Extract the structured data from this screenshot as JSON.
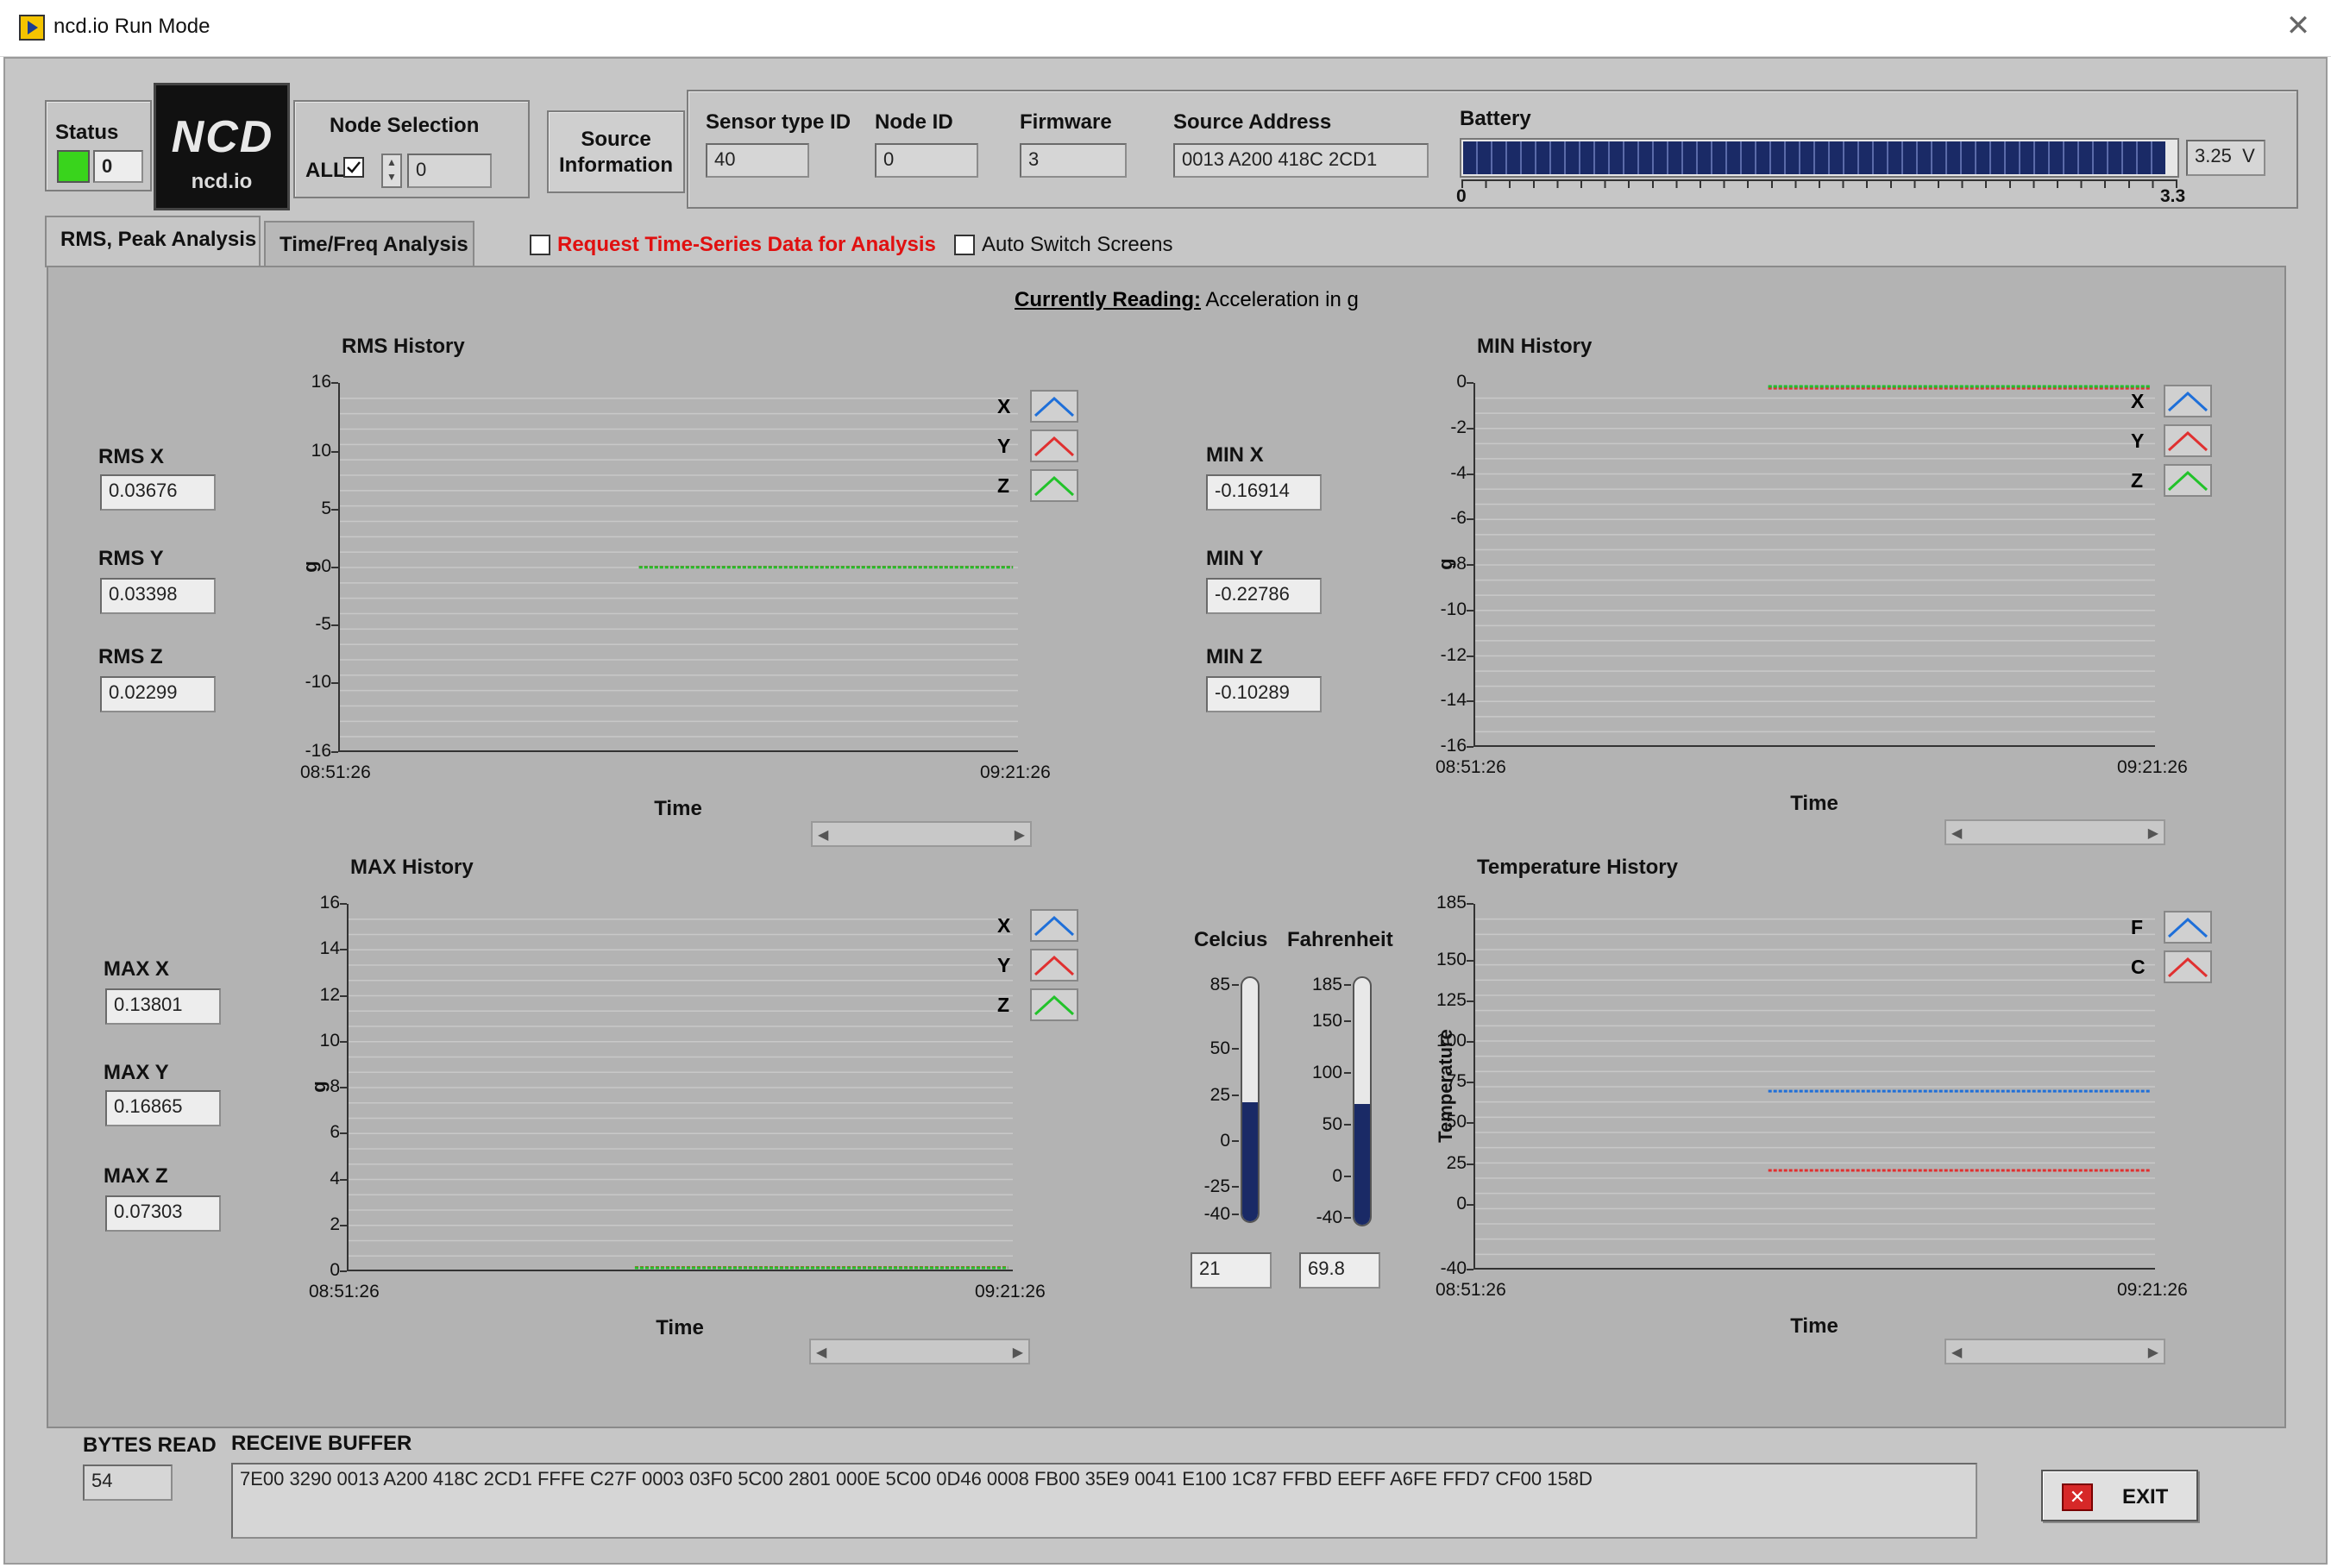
{
  "window": {
    "title": "ncd.io Run Mode",
    "close": "✕"
  },
  "status": {
    "label": "Status",
    "value": "0",
    "led_color": "#39d41c"
  },
  "logo": {
    "big": "NCD",
    "small": "ncd.io"
  },
  "node_selection": {
    "label": "Node Selection",
    "all_label": "ALL",
    "all_checked": true,
    "value": "0"
  },
  "source_info": {
    "button_label_1": "Source",
    "button_label_2": "Information"
  },
  "sensor": {
    "type_label": "Sensor type ID",
    "type_value": "40",
    "node_label": "Node ID",
    "node_value": "0",
    "firmware_label": "Firmware",
    "firmware_value": "3",
    "address_label": "Source Address",
    "address_value": "0013 A200 418C 2CD1"
  },
  "battery": {
    "label": "Battery",
    "value": "3.25",
    "unit": "V",
    "min": "0",
    "max": "3.3",
    "level": 0.985
  },
  "tabs": [
    {
      "label": "RMS, Peak Analysis",
      "active": true
    },
    {
      "label": "Time/Freq Analysis",
      "active": false
    }
  ],
  "request_ts": {
    "label": "Request Time-Series Data for Analysis",
    "checked": false
  },
  "auto_switch": {
    "label": "Auto Switch Screens",
    "checked": false
  },
  "currently_reading": {
    "label": "Currently Reading:",
    "value": "Acceleration in g"
  },
  "readouts": {
    "rms": [
      {
        "label": "RMS X",
        "value": "0.03676"
      },
      {
        "label": "RMS Y",
        "value": "0.03398"
      },
      {
        "label": "RMS Z",
        "value": "0.02299"
      }
    ],
    "min": [
      {
        "label": "MIN  X",
        "value": "-0.16914"
      },
      {
        "label": "MIN  Y",
        "value": "-0.22786"
      },
      {
        "label": "MIN  Z",
        "value": "-0.10289"
      }
    ],
    "max": [
      {
        "label": "MAX X",
        "value": "0.13801"
      },
      {
        "label": "MAX Y",
        "value": "0.16865"
      },
      {
        "label": "MAX Z",
        "value": "0.07303"
      }
    ]
  },
  "series_colors": {
    "X": "#1e6fd9",
    "Y": "#e03030",
    "Z": "#22c22a",
    "F": "#1e6fd9",
    "C": "#e03030"
  },
  "chart_data": [
    {
      "id": "rms",
      "type": "line",
      "title": "RMS History",
      "xlabel": "Time",
      "ylabel": "g",
      "xticks": [
        "08:51:26",
        "09:21:26"
      ],
      "yticks": [
        "16",
        "10",
        "5",
        "0",
        "-5",
        "-10",
        "-16"
      ],
      "ylim": [
        -16,
        16
      ],
      "series": [
        {
          "name": "X",
          "x_range": [
            0.44,
            0.99
          ],
          "values": [
            0.037,
            0.037
          ]
        },
        {
          "name": "Y",
          "x_range": [
            0.44,
            0.99
          ],
          "values": [
            0.034,
            0.034
          ]
        },
        {
          "name": "Z",
          "x_range": [
            0.44,
            0.99
          ],
          "values": [
            0.023,
            0.023
          ]
        }
      ],
      "legend": [
        "X",
        "Y",
        "Z"
      ]
    },
    {
      "id": "min",
      "type": "line",
      "title": "MIN History",
      "xlabel": "Time",
      "ylabel": "g",
      "xticks": [
        "08:51:26",
        "09:21:26"
      ],
      "yticks": [
        "0",
        "-2",
        "-4",
        "-6",
        "-8",
        "-10",
        "-12",
        "-14",
        "-16"
      ],
      "ylim": [
        -16,
        0
      ],
      "series": [
        {
          "name": "X",
          "x_range": [
            0.43,
            0.99
          ],
          "values": [
            -0.17,
            -0.17
          ]
        },
        {
          "name": "Y",
          "x_range": [
            0.43,
            0.99
          ],
          "values": [
            -0.23,
            -0.23
          ]
        },
        {
          "name": "Z",
          "x_range": [
            0.43,
            0.99
          ],
          "values": [
            -0.1,
            -0.1
          ]
        }
      ],
      "legend": [
        "X",
        "Y",
        "Z"
      ]
    },
    {
      "id": "max",
      "type": "line",
      "title": "MAX History",
      "xlabel": "Time",
      "ylabel": "g",
      "xticks": [
        "08:51:26",
        "09:21:26"
      ],
      "yticks": [
        "16",
        "14",
        "12",
        "10",
        "8",
        "6",
        "4",
        "2",
        "0"
      ],
      "ylim": [
        0,
        16
      ],
      "series": [
        {
          "name": "X",
          "x_range": [
            0.43,
            0.99
          ],
          "values": [
            0.14,
            0.14
          ]
        },
        {
          "name": "Y",
          "x_range": [
            0.43,
            0.99
          ],
          "values": [
            0.17,
            0.17
          ]
        },
        {
          "name": "Z",
          "x_range": [
            0.43,
            0.99
          ],
          "values": [
            0.07,
            0.07
          ]
        }
      ],
      "legend": [
        "X",
        "Y",
        "Z"
      ]
    },
    {
      "id": "temp",
      "type": "line",
      "title": "Temperature History",
      "xlabel": "Time",
      "ylabel": "Temperature",
      "xticks": [
        "08:51:26",
        "09:21:26"
      ],
      "yticks": [
        "185",
        "150",
        "125",
        "100",
        "75",
        "50",
        "25",
        "0",
        "-40"
      ],
      "ylim": [
        -40,
        185
      ],
      "series": [
        {
          "name": "F",
          "x_range": [
            0.43,
            0.99
          ],
          "values": [
            69.8,
            69.8
          ]
        },
        {
          "name": "C",
          "x_range": [
            0.43,
            0.99
          ],
          "values": [
            21,
            21
          ]
        }
      ],
      "legend": [
        "F",
        "C"
      ]
    }
  ],
  "thermo": {
    "celsius": {
      "label": "Celcius",
      "ticks": [
        "85",
        "50",
        "25",
        "0",
        "-25",
        "-40"
      ],
      "min": -40,
      "max": 85,
      "value": 21,
      "display": "21"
    },
    "fahrenheit": {
      "label": "Fahrenheit",
      "ticks": [
        "185",
        "150",
        "100",
        "50",
        "0",
        "-40"
      ],
      "min": -40,
      "max": 185,
      "value": 69.8,
      "display": "69.8"
    }
  },
  "footer": {
    "bytes_label": "BYTES READ",
    "bytes_value": "54",
    "buffer_label": "RECEIVE BUFFER",
    "buffer_value": "7E00 3290 0013 A200 418C 2CD1 FFFE C27F 0003 03F0 5C00 2801 000E 5C00 0D46 0008 FB00 35E9 0041 E100 1C87 FFBD EEFF A6FE FFD7 CF00 158D",
    "exit_label": "EXIT"
  }
}
